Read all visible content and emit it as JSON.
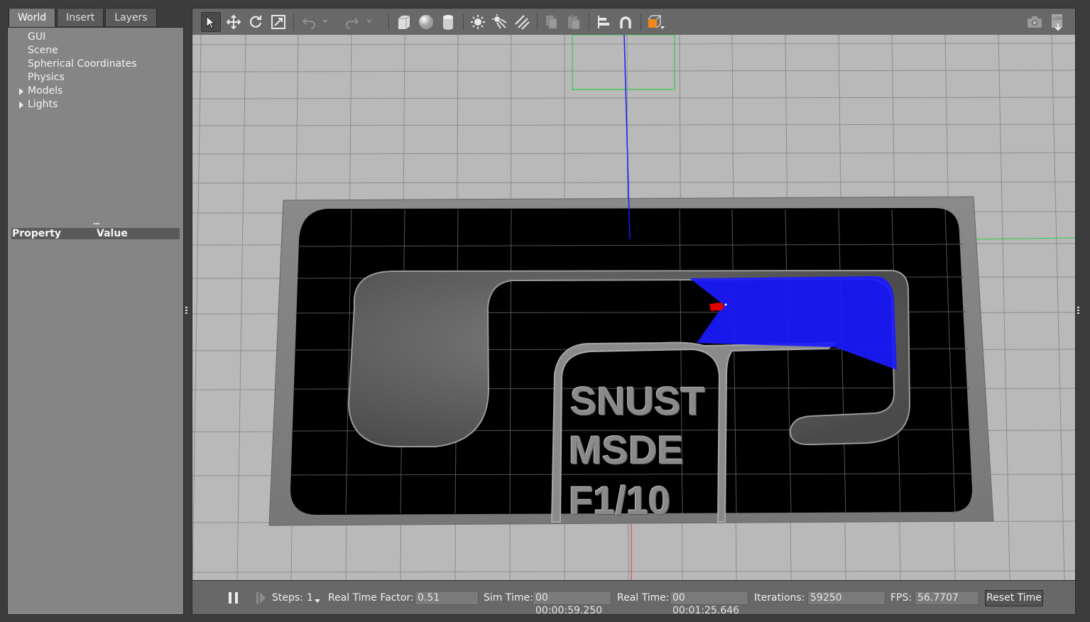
{
  "left_tabs": [
    "World",
    "Insert",
    "Layers"
  ],
  "world_tree": [
    {
      "label": "GUI",
      "expandable": false
    },
    {
      "label": "Scene",
      "expandable": false
    },
    {
      "label": "Spherical Coordinates",
      "expandable": false
    },
    {
      "label": "Physics",
      "expandable": false
    },
    {
      "label": "Models",
      "expandable": true
    },
    {
      "label": "Lights",
      "expandable": true
    }
  ],
  "properties": {
    "col_property": "Property",
    "col_value": "Value"
  },
  "toolbar": {
    "tools": [
      "select-arrow-icon",
      "translate-icon",
      "rotate-icon",
      "scale-icon",
      "undo-icon",
      "redo-icon",
      "box-shape-icon",
      "sphere-shape-icon",
      "cylinder-shape-icon",
      "point-light-icon",
      "spot-light-icon",
      "directional-light-icon",
      "copy-icon",
      "paste-icon",
      "align-icon",
      "snap-icon",
      "view-angle-icon",
      "screenshot-icon",
      "log-icon"
    ],
    "colors": {
      "accent_orange": "#f08a1c",
      "laser_blue": "#1a1aff",
      "car_red": "#e00000"
    }
  },
  "scene": {
    "track_text": [
      "SNUST",
      "MSDE",
      "F1/10"
    ]
  },
  "bottom": {
    "steps_label": "Steps:",
    "steps_value": "1",
    "rtf_label": "Real Time Factor:",
    "rtf_value": "0.51",
    "sim_time_label": "Sim Time:",
    "sim_time_value": "00 00:00:59.250",
    "real_time_label": "Real Time:",
    "real_time_value": "00 00:01:25.646",
    "iterations_label": "Iterations:",
    "iterations_value": "59250",
    "fps_label": "FPS:",
    "fps_value": "56.7707",
    "reset_label": "Reset Time"
  }
}
